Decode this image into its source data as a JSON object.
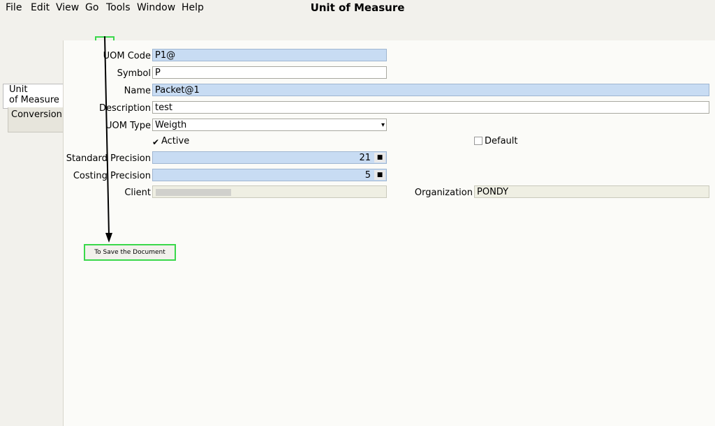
{
  "menu": [
    "File",
    "Edit",
    "View",
    "Go",
    "Tools",
    "Window",
    "Help"
  ],
  "window_title": "Unit of Measure",
  "tabs": [
    "Unit\nof Measure",
    "Conversion"
  ],
  "fields": {
    "uom_code": {
      "label": "UOM Code",
      "value": "P1@"
    },
    "symbol": {
      "label": "Symbol",
      "value": "P"
    },
    "name": {
      "label": "Name",
      "value": "Packet@1"
    },
    "description": {
      "label": "Description",
      "value": "test"
    },
    "uom_type": {
      "label": "UOM Type",
      "value": "Weigth"
    },
    "active": {
      "label": "Active"
    },
    "default": {
      "label": "Default"
    },
    "std_precision": {
      "label": "Standard Precision",
      "value": "21"
    },
    "cost_precision": {
      "label": "Costing Precision",
      "value": "5"
    },
    "client": {
      "label": "Client",
      "value": ""
    },
    "organization": {
      "label": "Organization",
      "value": "PONDY"
    }
  },
  "annotation": {
    "label": "To Save the Document"
  },
  "icons": [
    "undo-icon",
    "help-icon",
    "new-icon",
    "copy-icon",
    "delete-icon",
    "save-icon",
    "refresh-icon",
    "find-icon",
    "attachment-icon",
    "chat-icon",
    "history-icon",
    "home-icon",
    "previous-icon",
    "next-icon",
    "first-icon",
    "up-icon",
    "down-icon",
    "last-icon",
    "report-icon",
    "archive-icon",
    "print-icon",
    "print-preview-icon",
    "zoom-icon",
    "workflow-icon",
    "product-info-icon",
    "end-icon"
  ]
}
